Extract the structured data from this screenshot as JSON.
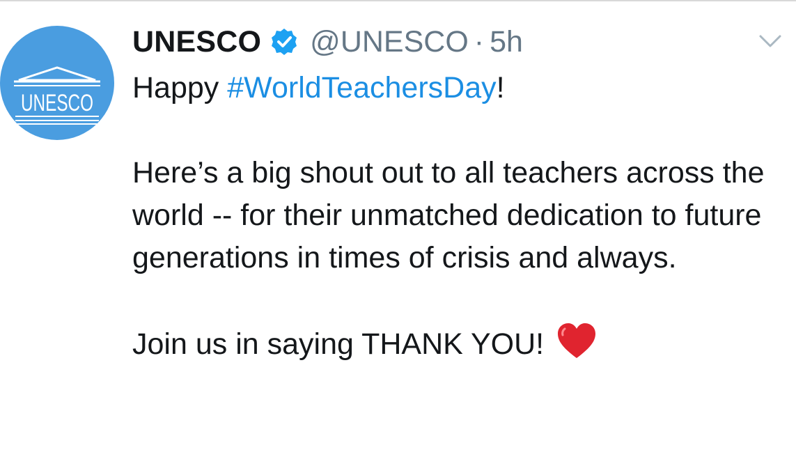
{
  "account": {
    "name": "UNESCO",
    "handle": "@UNESCO",
    "separator": "·",
    "time": "5h",
    "avatar_logo_text": "UNESCO",
    "verified": true
  },
  "tweet": {
    "line1_prefix": "Happy ",
    "hashtag": "#WorldTeachersDay",
    "line1_suffix": "!",
    "paragraph2": "Here’s a big shout out to all teachers across the world -- for their unmatched dedication to future generations in times of crisis and always.",
    "paragraph3": "Join us in saying THANK YOU!",
    "emoji": "heart-icon"
  },
  "colors": {
    "avatar_bg": "#4a9de0",
    "verified_badge": "#1da1f2",
    "hashtag": "#1b8ee3",
    "secondary_text": "#657786",
    "heart": "#e0242f"
  }
}
